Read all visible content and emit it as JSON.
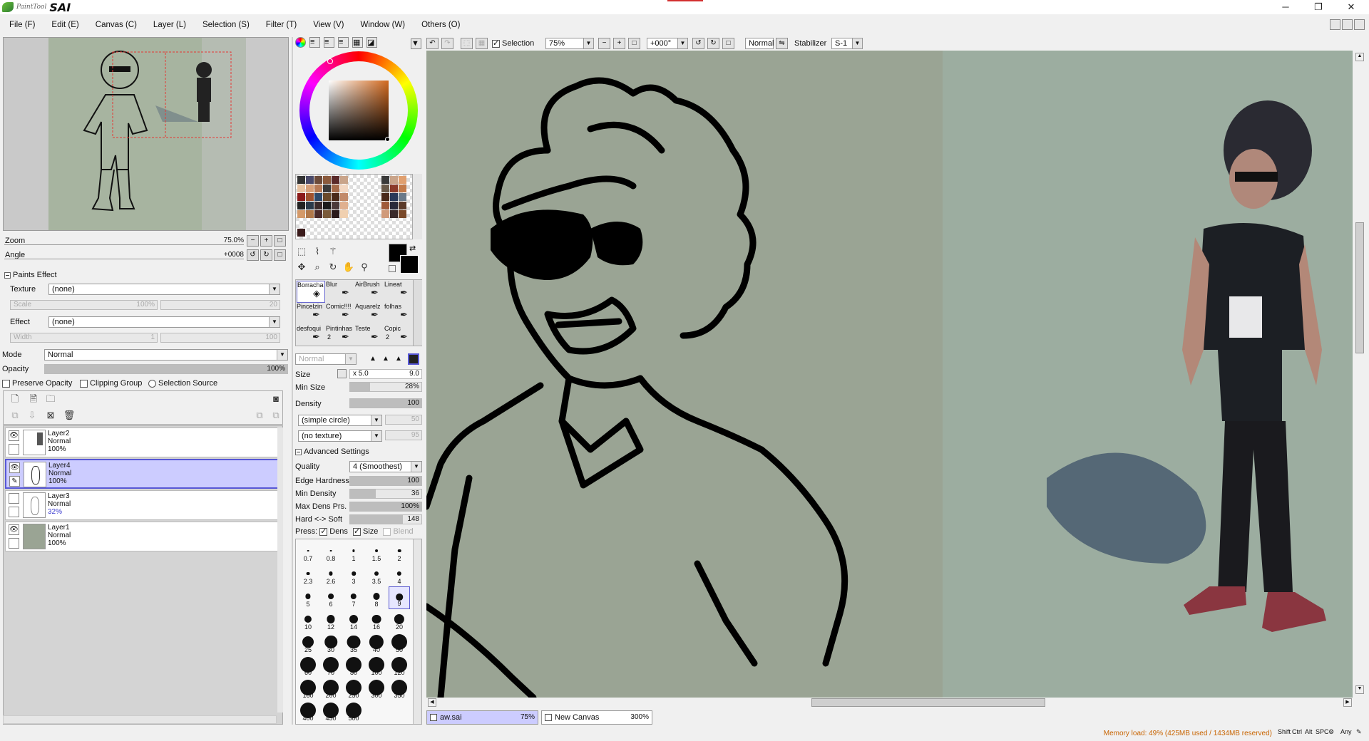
{
  "app": {
    "logo_small": "PaintTool",
    "logo_big": "SAI",
    "window_controls": [
      "─",
      "❐",
      "✕"
    ]
  },
  "menu": [
    "File (F)",
    "Edit (E)",
    "Canvas (C)",
    "Layer (L)",
    "Selection (S)",
    "Filter (T)",
    "View (V)",
    "Window (W)",
    "Others (O)"
  ],
  "navigator": {
    "zoom_label": "Zoom",
    "zoom_value": "75.0%",
    "angle_label": "Angle",
    "angle_value": "+0008"
  },
  "paints_effect": {
    "header": "Paints Effect",
    "texture_label": "Texture",
    "texture_value": "(none)",
    "scale_label": "Scale",
    "scale_value": "100%",
    "scale_right": "20",
    "effect_label": "Effect",
    "effect_value": "(none)",
    "width_label": "Width",
    "width_value": "1",
    "width_right": "100"
  },
  "layer_props": {
    "mode_label": "Mode",
    "mode_value": "Normal",
    "opacity_label": "Opacity",
    "opacity_value": "100%",
    "opacity_level": 1.0,
    "preserve_opacity": "Preserve Opacity",
    "clipping_group": "Clipping Group",
    "selection_source": "Selection Source"
  },
  "layers": [
    {
      "name": "Layer2",
      "mode": "Normal",
      "opacity": "100%",
      "visible": true,
      "selected": false
    },
    {
      "name": "Layer4",
      "mode": "Normal",
      "opacity": "100%",
      "visible": true,
      "selected": true
    },
    {
      "name": "Layer3",
      "mode": "Normal",
      "opacity": "32%",
      "visible": false,
      "selected": false
    },
    {
      "name": "Layer1",
      "mode": "Normal",
      "opacity": "100%",
      "visible": true,
      "selected": false
    }
  ],
  "tools": [
    {
      "name": "Borracha",
      "num": ""
    },
    {
      "name": "Blur",
      "num": ""
    },
    {
      "name": "AirBrush",
      "num": ""
    },
    {
      "name": "Lineat",
      "num": ""
    },
    {
      "name": "Pincelzin",
      "num": ""
    },
    {
      "name": "Comic!!!!",
      "num": ""
    },
    {
      "name": "Aquarelz",
      "num": ""
    },
    {
      "name": "folhas",
      "num": ""
    },
    {
      "name": "desfoqui",
      "num": ""
    },
    {
      "name": "Pintinhas",
      "num": "2"
    },
    {
      "name": "Teste",
      "num": ""
    },
    {
      "name": "Copic",
      "num": "2"
    }
  ],
  "brush": {
    "blend_mode": "Normal",
    "size_label": "Size",
    "size_mult": "x 5.0",
    "size_value": "9.0",
    "min_size_label": "Min Size",
    "min_size_value": "28%",
    "min_size_level": 0.28,
    "density_label": "Density",
    "density_value": "100",
    "density_level": 1.0,
    "shape": "(simple circle)",
    "shape_right": "50",
    "texture": "(no texture)",
    "texture_right": "95",
    "advanced_header": "Advanced Settings",
    "quality_label": "Quality",
    "quality_value": "4 (Smoothest)",
    "edge_hardness_label": "Edge Hardness",
    "edge_hardness_value": "100",
    "edge_hardness_level": 1.0,
    "min_density_label": "Min Density",
    "min_density_value": "36",
    "min_density_level": 0.36,
    "max_dens_label": "Max Dens Prs.",
    "max_dens_value": "100%",
    "max_dens_level": 1.0,
    "hard_soft_label": "Hard <-> Soft",
    "hard_soft_value": "148",
    "hard_soft_level": 0.74,
    "press_label": "Press:",
    "press_dens": "Dens",
    "press_size": "Size",
    "press_blend": "Blend"
  },
  "brush_sizes": [
    "0.7",
    "0.8",
    "1",
    "1.5",
    "2",
    "2.3",
    "2.6",
    "3",
    "3.5",
    "4",
    "5",
    "6",
    "7",
    "8",
    "9",
    "10",
    "12",
    "14",
    "16",
    "20",
    "25",
    "30",
    "35",
    "40",
    "50",
    "60",
    "70",
    "80",
    "100",
    "120",
    "160",
    "200",
    "250",
    "300",
    "350",
    "400",
    "450",
    "500"
  ],
  "canvas_toolbar": {
    "selection_label": "Selection",
    "zoom_value": "75%",
    "angle_value": "+000°",
    "blend_value": "Normal",
    "stabilizer_label": "Stabilizer",
    "stabilizer_value": "S-1"
  },
  "tabs": [
    {
      "name": "aw.sai",
      "zoom": "75%",
      "active": true
    },
    {
      "name": "New Canvas",
      "zoom": "300%",
      "active": false
    }
  ],
  "status": {
    "memory": "Memory load: 49% (425MB used / 1434MB reserved)",
    "indicators": [
      "Shift",
      "Ctrl",
      "Alt",
      "SPC",
      "Any"
    ]
  },
  "colors": {
    "canvas_bg": "#9aa494",
    "selected_layer": "#ccccff",
    "accent": "#5757d6",
    "memory_text": "#c86400"
  }
}
